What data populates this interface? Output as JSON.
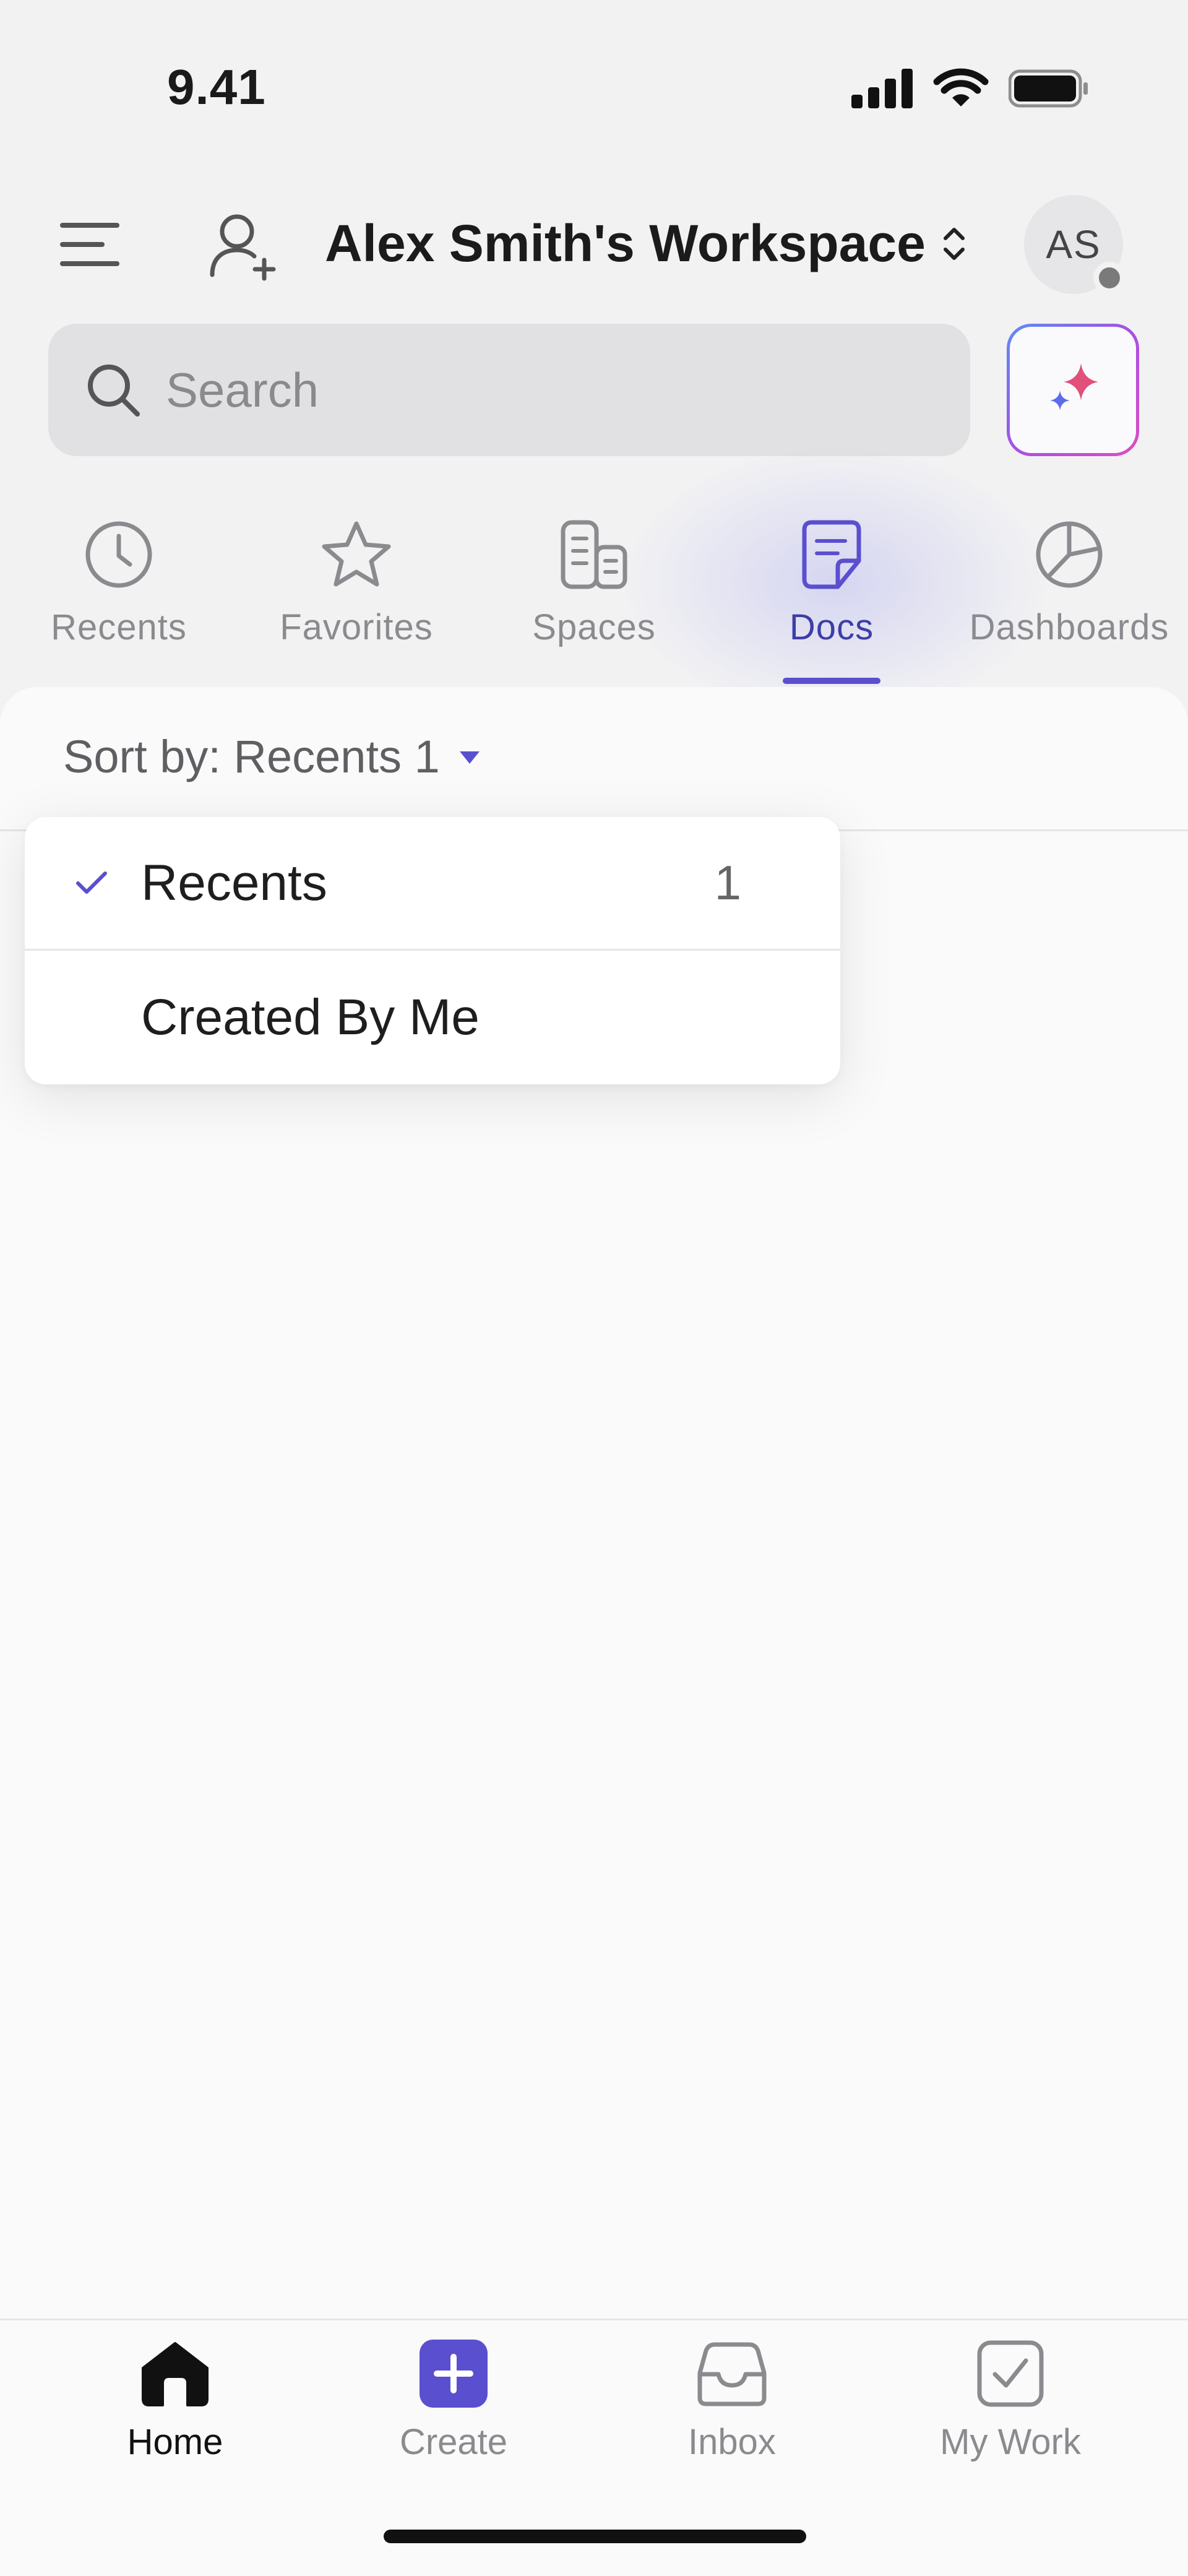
{
  "status_bar": {
    "time": "9.41"
  },
  "header": {
    "workspace_name": "Alex Smith's Workspace",
    "avatar_initials": "AS"
  },
  "search": {
    "placeholder": "Search"
  },
  "tabs": [
    {
      "label": "Recents",
      "icon": "clock-icon",
      "active": false
    },
    {
      "label": "Favorites",
      "icon": "star-icon",
      "active": false
    },
    {
      "label": "Spaces",
      "icon": "spaces-icon",
      "active": false
    },
    {
      "label": "Docs",
      "icon": "doc-icon",
      "active": true
    },
    {
      "label": "Dashboards",
      "icon": "pie-chart-icon",
      "active": false
    }
  ],
  "sort": {
    "label": "Sort by: Recents 1"
  },
  "dropdown": {
    "items": [
      {
        "label": "Recents",
        "count": "1",
        "selected": true
      },
      {
        "label": "Created By Me",
        "selected": false
      }
    ]
  },
  "bottom_nav": [
    {
      "label": "Home",
      "icon": "home-icon",
      "active": true
    },
    {
      "label": "Create",
      "icon": "plus-icon",
      "active": false
    },
    {
      "label": "Inbox",
      "icon": "inbox-icon",
      "active": false
    },
    {
      "label": "My Work",
      "icon": "checkbox-icon",
      "active": false
    }
  ],
  "colors": {
    "accent": "#5a4fcf",
    "active_tab_text": "#3e3ea6",
    "background": "#f2f2f3"
  }
}
